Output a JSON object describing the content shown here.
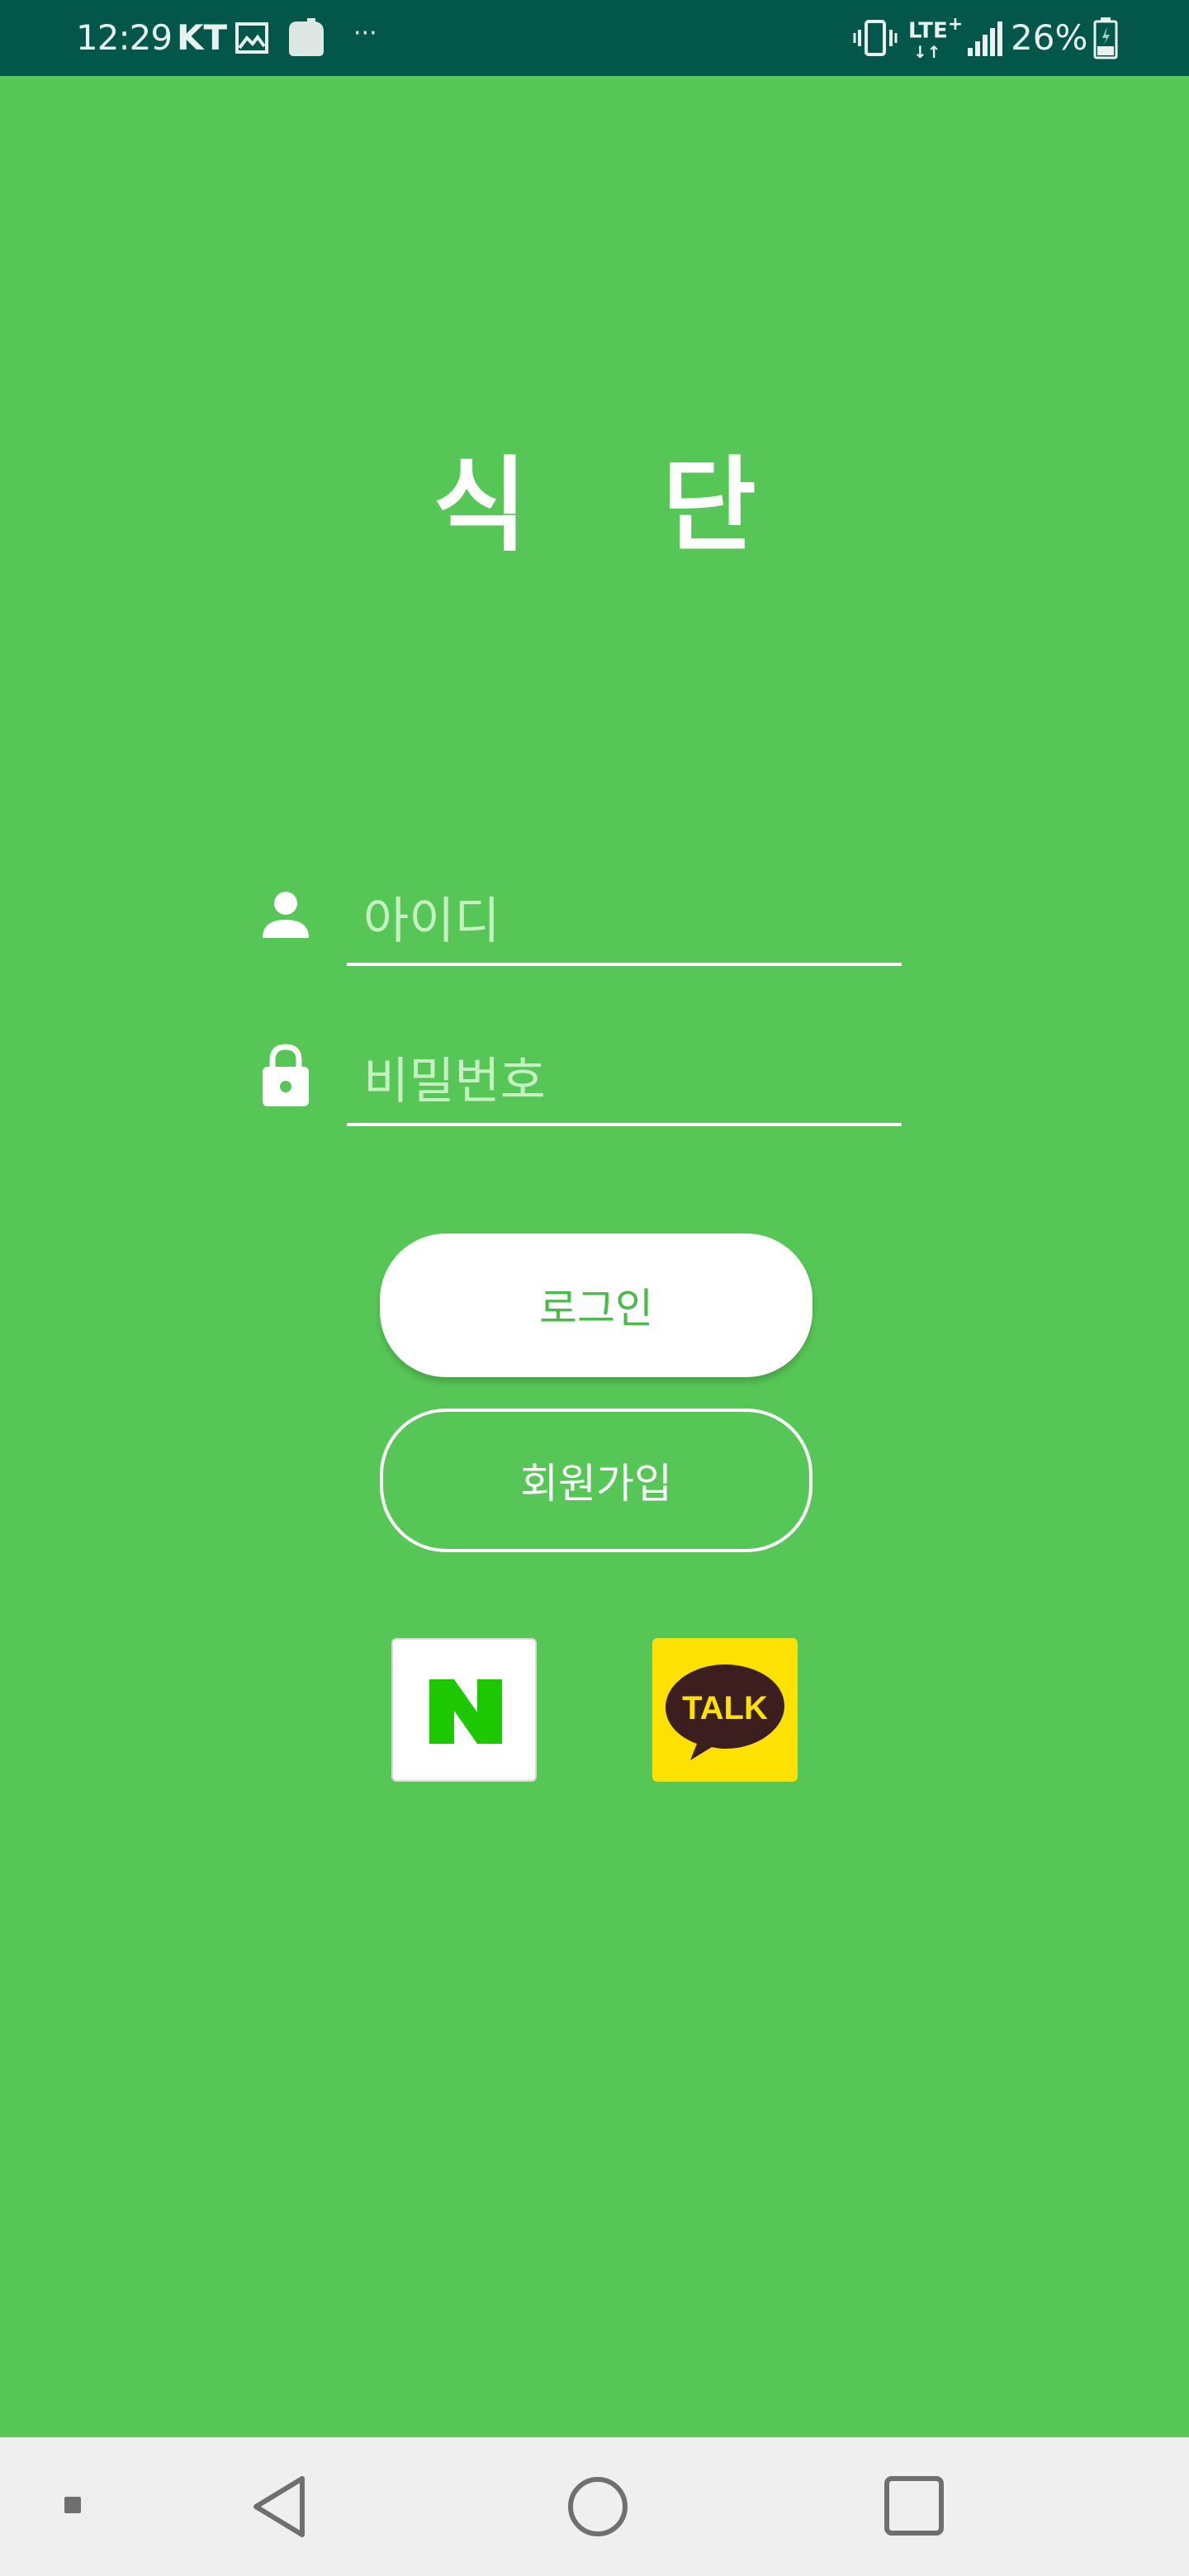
{
  "status_bar": {
    "time": "12:29",
    "carrier": "KT",
    "more": "···",
    "network": "LTE",
    "network_sup": "+",
    "battery_percent": "26%",
    "icons": [
      "gallery-icon",
      "clipboard-icon",
      "vibrate-icon",
      "lte-icon",
      "signal-icon",
      "battery-icon"
    ]
  },
  "title": "식 단",
  "login_form": {
    "id_placeholder": "아이디",
    "password_placeholder": "비밀번호",
    "id_icon": "user-icon",
    "password_icon": "lock-icon"
  },
  "buttons": {
    "login_label": "로그인",
    "signup_label": "회원가입"
  },
  "social_login": {
    "naver_letter": "N",
    "kakao_label": "TALK"
  },
  "nav_bar": {
    "icons": [
      "recent-dot-icon",
      "back-icon",
      "home-icon",
      "recents-icon"
    ]
  },
  "colors": {
    "background": "#56c756",
    "status_bar": "#02574a",
    "naver_green": "#1ec800",
    "kakao_yellow": "#fce101",
    "kakao_brown": "#3c1e1e",
    "nav_bar": "#efefef"
  }
}
